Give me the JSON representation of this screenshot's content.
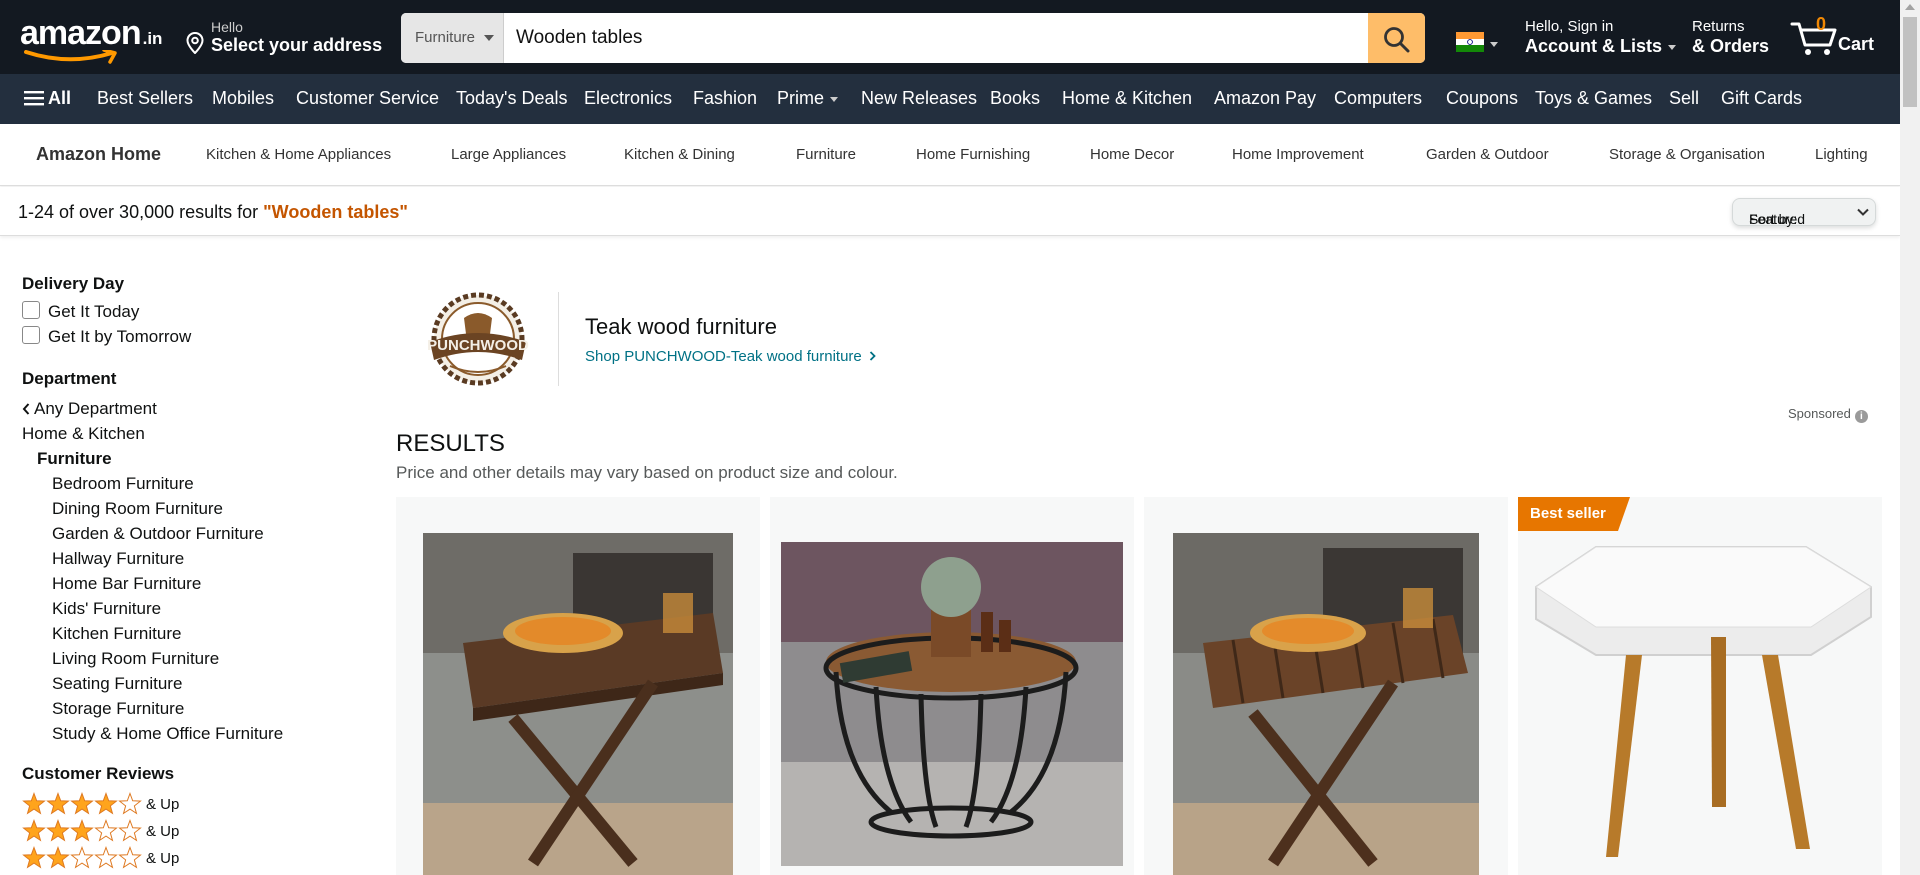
{
  "header": {
    "logo_text": "amazon",
    "logo_tld": ".in",
    "address_hello": "Hello",
    "address_select": "Select your address",
    "search_category": "Furniture",
    "search_value": "Wooden tables",
    "account_hello": "Hello, Sign in",
    "account_lists": "Account & Lists",
    "returns_l1": "Returns",
    "returns_l2": "& Orders",
    "cart_count": "0",
    "cart_label": "Cart"
  },
  "nav": {
    "all_label": "All",
    "items": [
      "Best Sellers",
      "Mobiles",
      "Customer Service",
      "Today's Deals",
      "Electronics",
      "Fashion",
      "Prime",
      "New Releases",
      "Books",
      "Home & Kitchen",
      "Amazon Pay",
      "Computers",
      "Coupons",
      "Toys & Games",
      "Sell",
      "Gift Cards"
    ]
  },
  "subnav": {
    "home": "Amazon Home",
    "items": [
      "Kitchen & Home Appliances",
      "Large Appliances",
      "Kitchen & Dining",
      "Furniture",
      "Home Furnishing",
      "Home Decor",
      "Home Improvement",
      "Garden & Outdoor",
      "Storage & Organisation",
      "Lighting"
    ]
  },
  "results_bar": {
    "prefix": "1-24 of over 30,000 results for ",
    "query": "\"Wooden tables\"",
    "sort_label": "Sort by:",
    "sort_value": "Featured"
  },
  "sidebar": {
    "delivery_heading": "Delivery Day",
    "delivery_options": [
      "Get It Today",
      "Get It by Tomorrow"
    ],
    "department_heading": "Department",
    "any_department": "Any Department",
    "home_kitchen": "Home & Kitchen",
    "furniture": "Furniture",
    "subcategories": [
      "Bedroom Furniture",
      "Dining Room Furniture",
      "Garden & Outdoor Furniture",
      "Hallway Furniture",
      "Home Bar Furniture",
      "Kids' Furniture",
      "Kitchen Furniture",
      "Living Room Furniture",
      "Seating Furniture",
      "Storage Furniture",
      "Study & Home Office Furniture"
    ],
    "reviews_heading": "Customer Reviews",
    "review_rows": [
      {
        "stars": 4,
        "label": "& Up"
      },
      {
        "stars": 3,
        "label": "& Up"
      },
      {
        "stars": 2,
        "label": "& Up"
      }
    ]
  },
  "brand": {
    "logo_text": "PUNCHWOOD",
    "title": "Teak wood furniture",
    "link": "Shop PUNCHWOOD-Teak wood furniture",
    "sponsored": "Sponsored"
  },
  "results": {
    "heading": "RESULTS",
    "subheading": "Price and other details may vary based on product size and colour.",
    "cards": [
      {
        "badge": ""
      },
      {
        "badge": ""
      },
      {
        "badge": ""
      },
      {
        "badge": "Best seller"
      }
    ]
  },
  "colors": {
    "header_bg": "#131921",
    "nav_bg": "#232f3e",
    "search_button": "#febd69",
    "query_orange": "#c45500",
    "link_teal": "#007185",
    "star": "#ffa41c",
    "badge": "#e77600"
  }
}
